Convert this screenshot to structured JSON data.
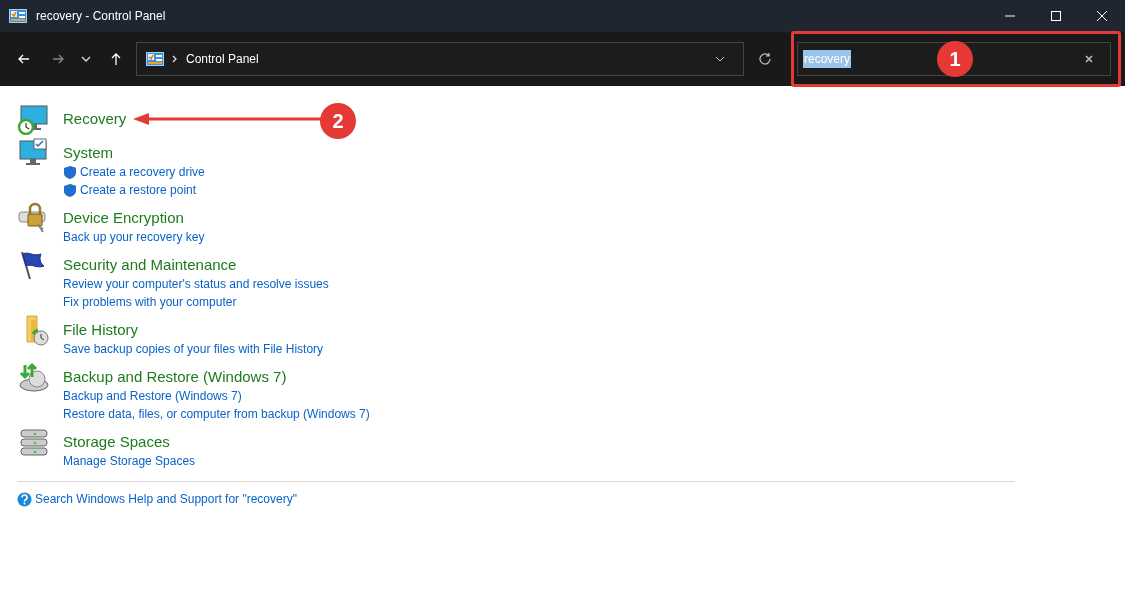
{
  "window": {
    "title": "recovery - Control Panel"
  },
  "address_bar": {
    "path": [
      "Control Panel"
    ]
  },
  "search": {
    "value": "recovery",
    "text_selected": true
  },
  "results": [
    {
      "title": "Recovery"
    },
    {
      "title": "System",
      "links": [
        {
          "label": "Create a recovery drive",
          "shield": true
        },
        {
          "label": "Create a restore point",
          "shield": true
        }
      ]
    },
    {
      "title": "Device Encryption",
      "links": [
        {
          "label": "Back up your recovery key",
          "shield": false
        }
      ]
    },
    {
      "title": "Security and Maintenance",
      "links": [
        {
          "label": "Review your computer's status and resolve issues",
          "shield": false
        },
        {
          "label": "Fix problems with your computer",
          "shield": false
        }
      ]
    },
    {
      "title": "File History",
      "links": [
        {
          "label": "Save backup copies of your files with File History",
          "shield": false
        }
      ]
    },
    {
      "title": "Backup and Restore (Windows 7)",
      "links": [
        {
          "label": "Backup and Restore (Windows 7)",
          "shield": false
        },
        {
          "label": "Restore data, files, or computer from backup (Windows 7)",
          "shield": false
        }
      ]
    },
    {
      "title": "Storage Spaces",
      "links": [
        {
          "label": "Manage Storage Spaces",
          "shield": false
        }
      ]
    }
  ],
  "help_link": "Search Windows Help and Support for \"recovery\"",
  "annotations": [
    {
      "label": "1"
    },
    {
      "label": "2"
    }
  ]
}
